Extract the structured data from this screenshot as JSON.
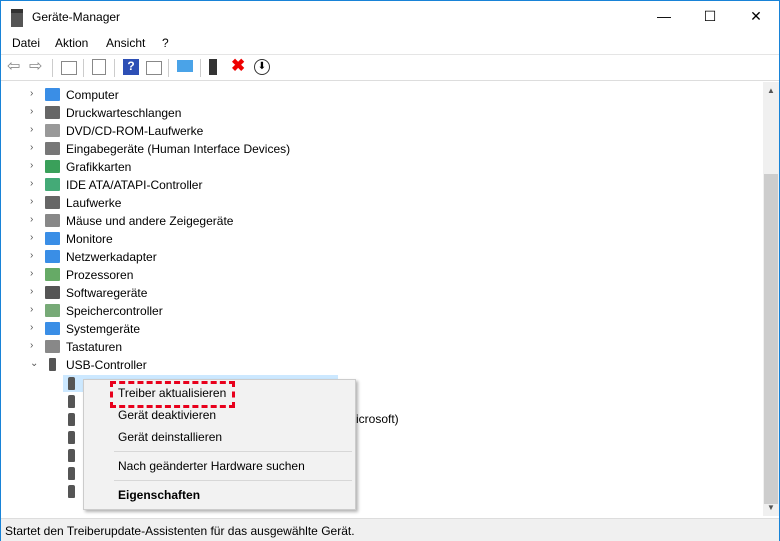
{
  "window": {
    "title": "Geräte-Manager",
    "minimize": "—",
    "maximize": "☐",
    "close": "✕"
  },
  "menubar": [
    "Datei",
    "Aktion",
    "Ansicht",
    "?"
  ],
  "toolbar": [
    "back",
    "forward",
    "show-hide-console-tree",
    "properties",
    "help",
    "action-pane",
    "scan-hardware",
    "update-driver",
    "uninstall",
    "disable"
  ],
  "tree": [
    {
      "label": "Computer",
      "color": "#3a8ee6"
    },
    {
      "label": "Druckwarteschlangen",
      "color": "#666"
    },
    {
      "label": "DVD/CD-ROM-Laufwerke",
      "color": "#999"
    },
    {
      "label": "Eingabegeräte (Human Interface Devices)",
      "color": "#777"
    },
    {
      "label": "Grafikkarten",
      "color": "#3aa05a"
    },
    {
      "label": "IDE ATA/ATAPI-Controller",
      "color": "#4a7"
    },
    {
      "label": "Laufwerke",
      "color": "#666"
    },
    {
      "label": "Mäuse und andere Zeigegeräte",
      "color": "#888"
    },
    {
      "label": "Monitore",
      "color": "#3a8ee6"
    },
    {
      "label": "Netzwerkadapter",
      "color": "#3a8ee6"
    },
    {
      "label": "Prozessoren",
      "color": "#6a6"
    },
    {
      "label": "Softwaregeräte",
      "color": "#555"
    },
    {
      "label": "Speichercontroller",
      "color": "#7a7"
    },
    {
      "label": "Systemgeräte",
      "color": "#3a8ee6"
    },
    {
      "label": "Tastaturen",
      "color": "#888"
    },
    {
      "label": "USB-Controller",
      "color": "#555"
    }
  ],
  "usb_partial_text": "icrosoft)",
  "context_menu": {
    "items": [
      "Treiber aktualisieren",
      "Gerät deaktivieren",
      "Gerät deinstallieren",
      "Nach geänderter Hardware suchen",
      "Eigenschaften"
    ]
  },
  "status": "Startet den Treiberupdate-Assistenten für das ausgewählte Gerät."
}
